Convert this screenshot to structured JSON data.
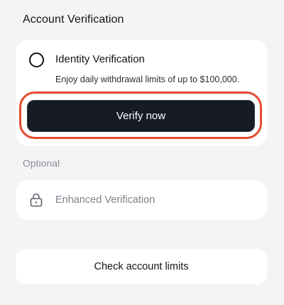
{
  "section": {
    "title": "Account Verification"
  },
  "identity": {
    "title": "Identity Verification",
    "description": "Enjoy daily withdrawal limits of up to $100,000.",
    "button_label": "Verify now",
    "selected": false
  },
  "optional": {
    "label": "Optional",
    "enhanced_label": "Enhanced Verification",
    "icon": "lock-icon"
  },
  "limits": {
    "button_label": "Check account limits"
  },
  "colors": {
    "background": "#f4f4f4",
    "card": "#ffffff",
    "primary_button": "#161b25",
    "highlight": "#e54a2f",
    "muted_text": "#8a8f98"
  }
}
